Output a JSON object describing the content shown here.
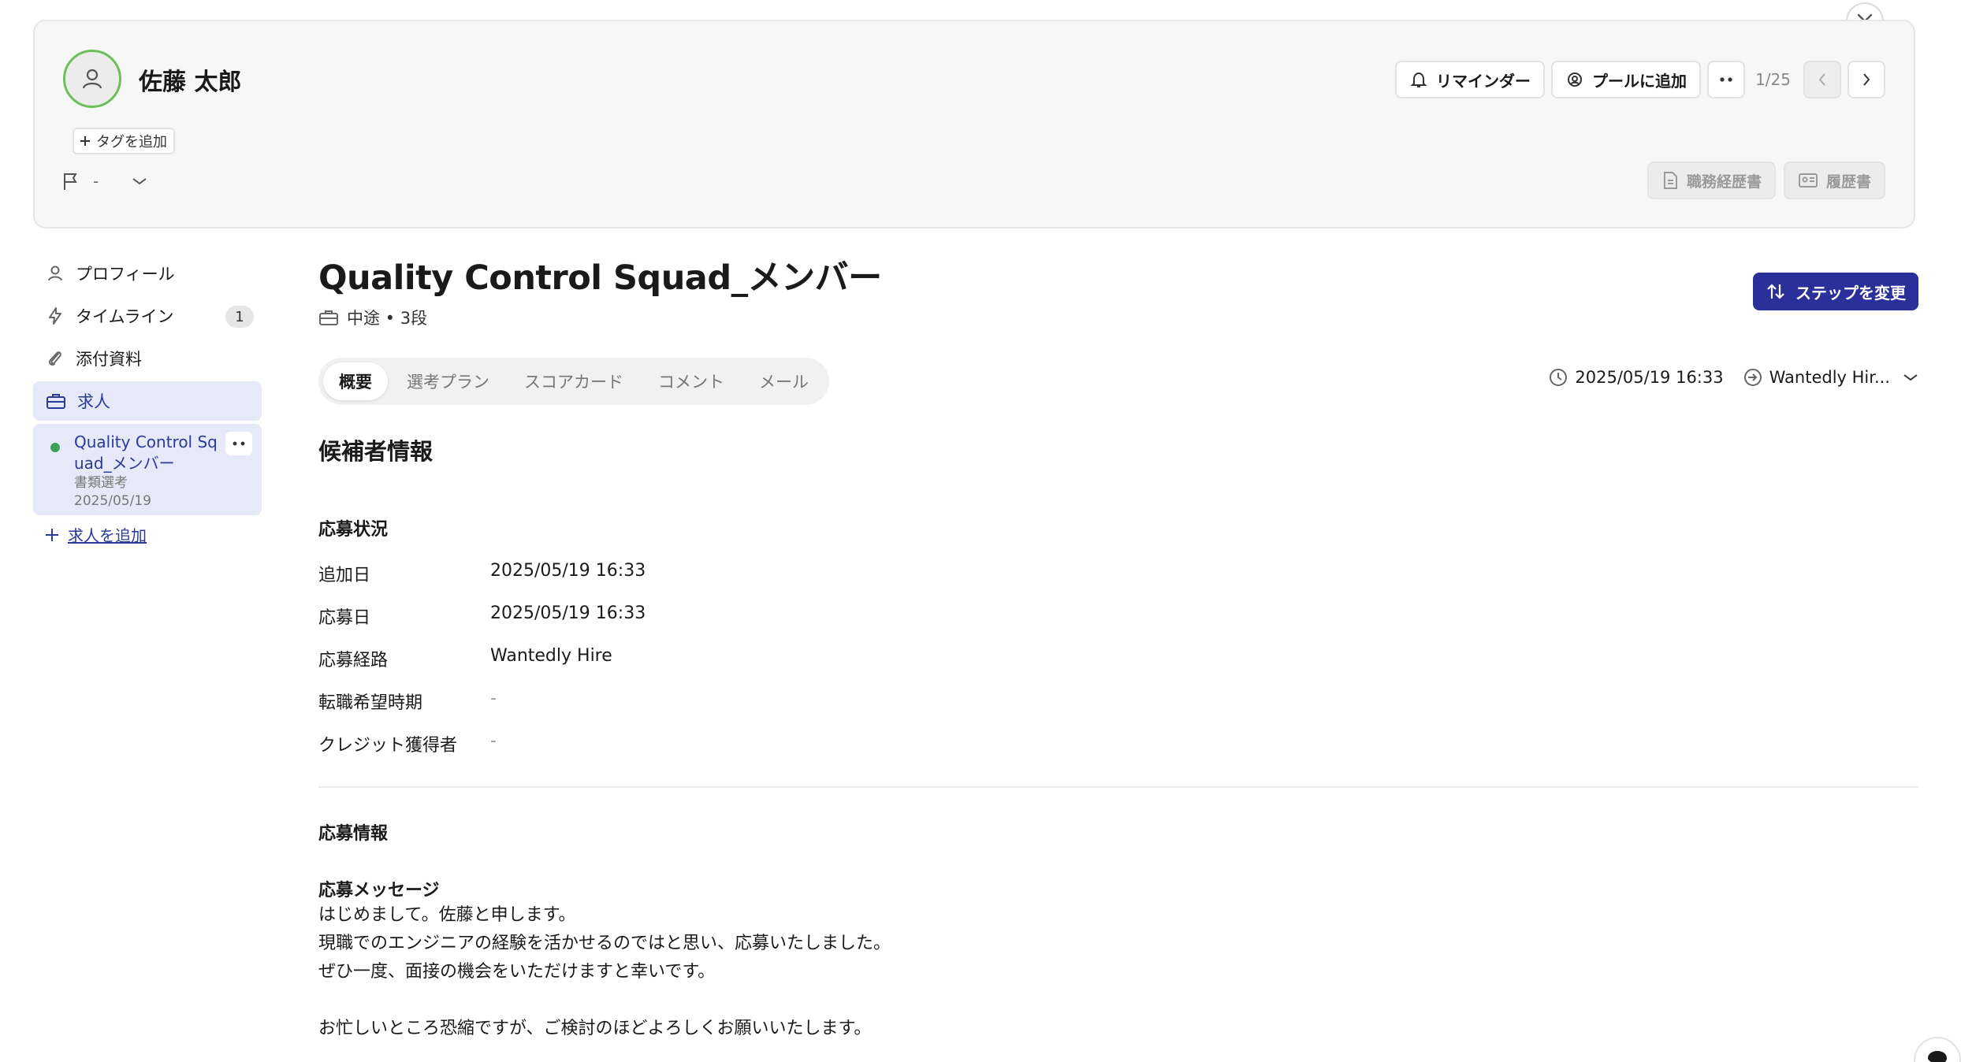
{
  "header": {
    "candidate_name": "佐藤 太郎",
    "add_tag_label": "タグを追加",
    "flag_value": "-",
    "reminder_label": "リマインダー",
    "add_pool_label": "プールに追加",
    "pager_count": "1/25",
    "work_history_label": "職務経歴書",
    "resume_label": "履歴書"
  },
  "sidebar": {
    "items": [
      {
        "label": "プロフィール",
        "icon": "person-icon"
      },
      {
        "label": "タイムライン",
        "icon": "lightning-icon",
        "badge": "1"
      },
      {
        "label": "添付資料",
        "icon": "paperclip-icon"
      },
      {
        "label": "求人",
        "icon": "briefcase-icon"
      }
    ],
    "job_card": {
      "title": "Quality Control Squad_メンバー",
      "stage": "書類選考",
      "date": "2025/05/19",
      "status_color": "#3fa05a"
    },
    "add_job_label": "求人を追加"
  },
  "main": {
    "job_title": "Quality Control Squad_メンバー",
    "job_meta": "中途 • 3段",
    "change_step_label": "ステップを変更",
    "tabs": [
      "概要",
      "選考プラン",
      "スコアカード",
      "コメント",
      "メール"
    ],
    "active_tab": "概要",
    "datetime": "2025/05/19 16:33",
    "source": "Wantedly Hir...",
    "section_candidate": "候補者情報",
    "section_status": "応募状況",
    "fields": [
      {
        "label": "追加日",
        "value": "2025/05/19 16:33"
      },
      {
        "label": "応募日",
        "value": "2025/05/19 16:33"
      },
      {
        "label": "応募経路",
        "value": "Wantedly Hire"
      },
      {
        "label": "転職希望時期",
        "value": "-"
      },
      {
        "label": "クレジット獲得者",
        "value": "-"
      }
    ],
    "section_application": "応募情報",
    "message_title": "応募メッセージ",
    "message_lines": [
      "はじめまして。佐藤と申します。",
      "現職でのエンジニアの経験を活かせるのではと思い、応募いたしました。",
      "ぜひ一度、面接の機会をいただけますと幸いです。",
      "お忙しいところ恐縮ですが、ご検討のほどよろしくお願いいたします。"
    ]
  },
  "colors": {
    "accent": "#2b2f99",
    "active_bg": "#e6e9f7",
    "avatar_ring": "#6cbf5a"
  }
}
